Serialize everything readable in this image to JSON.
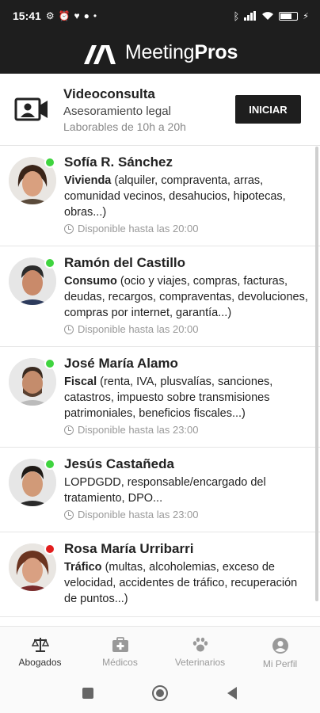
{
  "status_bar": {
    "time": "15:41",
    "battery_percent": 70
  },
  "app": {
    "brand_regular": "Meeting",
    "brand_bold": "Pros"
  },
  "videoconsulta": {
    "title": "Videoconsulta",
    "subtitle": "Asesoramiento legal",
    "hours": "Laborables de 10h a 20h",
    "button_label": "INICIAR"
  },
  "professionals": [
    {
      "name": "Sofía R. Sánchez",
      "specialty": "Vivienda",
      "description": " (alquiler, compraventa, arras, comunidad vecinos, desahucios, hipotecas, obras...)",
      "availability": "Disponible hasta las 20:00",
      "status_color": "#3fd43f"
    },
    {
      "name": "Ramón del Castillo",
      "specialty": "Consumo",
      "description": " (ocio y viajes, compras, facturas, deudas, recargos, compraventas, devoluciones, compras por internet, garantía...)",
      "availability": "Disponible hasta las 20:00",
      "status_color": "#3fd43f"
    },
    {
      "name": "José María Alamo",
      "specialty": "Fiscal",
      "description": " (renta, IVA, plusvalías, sanciones, catastros, impuesto sobre transmisiones patrimoniales, beneficios fiscales...)",
      "availability": "Disponible hasta las 23:00",
      "status_color": "#3fd43f"
    },
    {
      "name": "Jesús Castañeda",
      "specialty": "",
      "description": "LOPDGDD, responsable/encargado del tratamiento, DPO...",
      "availability": "Disponible hasta las 23:00",
      "status_color": "#3fd43f"
    },
    {
      "name": "Rosa María Urribarri",
      "specialty": "Tráfico",
      "description": " (multas, alcoholemias, exceso de velocidad, accidentes de tráfico, recuperación de puntos...)",
      "availability": "",
      "status_color": "#e21d1d"
    }
  ],
  "bottom_nav": [
    {
      "label": "Abogados",
      "icon": "scales-icon",
      "active": true
    },
    {
      "label": "Médicos",
      "icon": "medical-kit-icon",
      "active": false
    },
    {
      "label": "Veterinarios",
      "icon": "paw-icon",
      "active": false
    },
    {
      "label": "Mi Perfil",
      "icon": "profile-icon",
      "active": false
    }
  ],
  "colors": {
    "dark": "#1e1e1e",
    "online": "#3fd43f",
    "offline": "#e21d1d"
  }
}
